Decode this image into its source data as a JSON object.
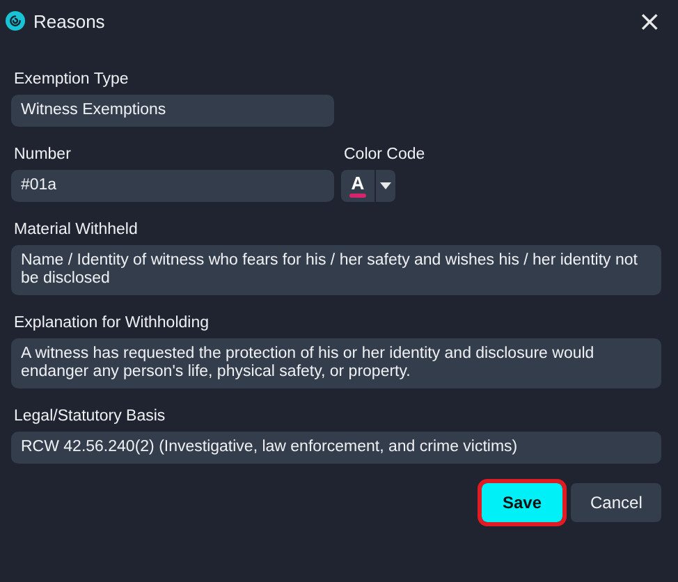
{
  "window": {
    "title": "Reasons",
    "close": "×"
  },
  "fields": [
    {
      "kind": "text",
      "label": "Exemption Type",
      "value": "Witness Exemptions"
    },
    {
      "kind": "number_color",
      "label": "Number",
      "value": "#01a",
      "color_label": "Color Code",
      "color_glyph": "A",
      "color": "#d6246e"
    },
    {
      "kind": "textarea",
      "label": "Material Withheld",
      "value": "Name / Identity of witness who fears for his / her safety and wishes his / her identity not be disclosed"
    },
    {
      "kind": "textarea",
      "label": "Explanation for Withholding",
      "value": "A witness has requested the protection of his or her identity and disclosure would endanger any person's life, physical safety, or property."
    },
    {
      "kind": "wide",
      "label": "Legal/Statutory Basis",
      "value": "RCW 42.56.240(2) (Investigative, law enforcement, and crime victims)"
    }
  ],
  "buttons": [
    {
      "label": "Save",
      "kind": "primary",
      "highlighted": true
    },
    {
      "label": "Cancel",
      "kind": "secondary",
      "highlighted": false
    }
  ]
}
